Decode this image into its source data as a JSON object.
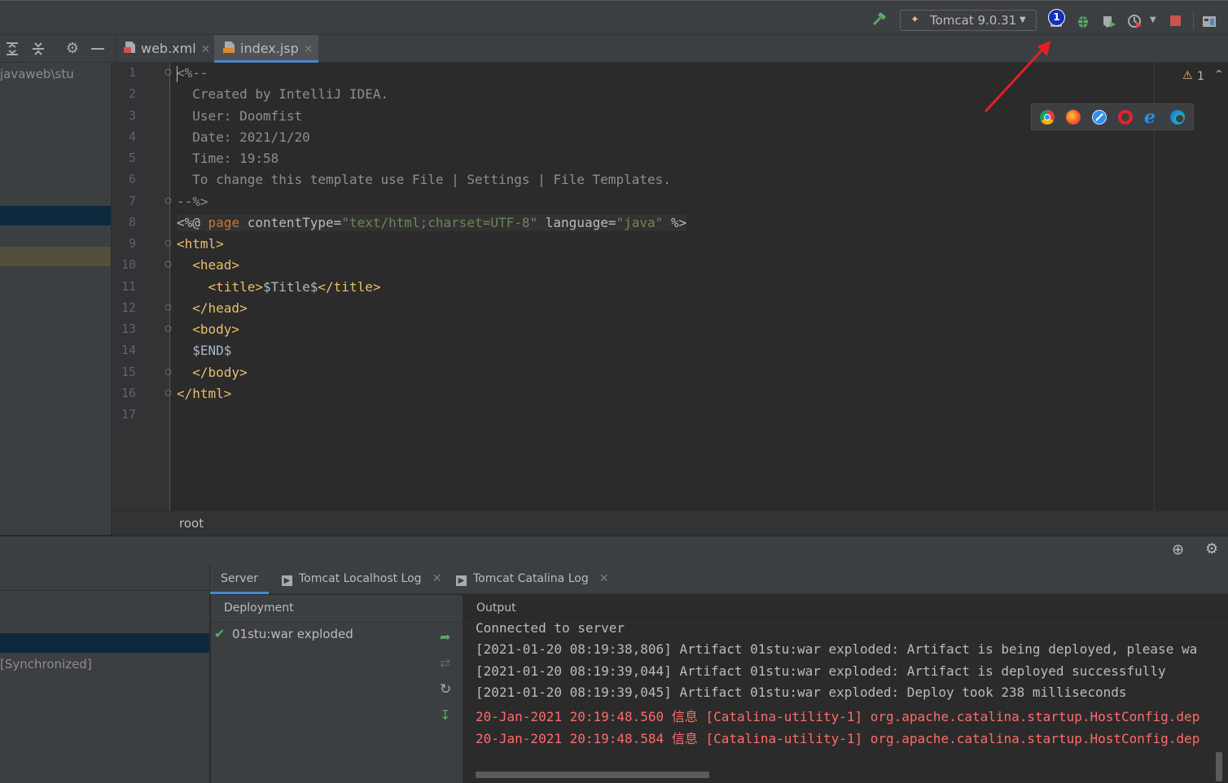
{
  "toolbar": {
    "run_config_label": "Tomcat 9.0.31",
    "annotation_badge": "1"
  },
  "project_pane": {
    "path_text": "javaweb\\stu"
  },
  "tabs": [
    {
      "label": "web.xml",
      "active": false
    },
    {
      "label": "index.jsp",
      "active": true
    }
  ],
  "inspection": {
    "warning_count": "1"
  },
  "editor": {
    "line_numbers": [
      "1",
      "2",
      "3",
      "4",
      "5",
      "6",
      "7",
      "8",
      "9",
      "10",
      "11",
      "12",
      "13",
      "14",
      "15",
      "16",
      "17"
    ],
    "lines": [
      "<%--",
      "  Created by IntelliJ IDEA.",
      "  User: Doomfist",
      "  Date: 2021/1/20",
      "  Time: 19:58",
      "  To change this template use File | Settings | File Templates.",
      "--%>",
      "<%@ page contentType=\"text/html;charset=UTF-8\" language=\"java\" %>",
      "<html>",
      "  <head>",
      "    <title>$Title$</title>",
      "  </head>",
      "  <body>",
      "  $END$",
      "  </body>",
      "</html>",
      ""
    ],
    "breadcrumb": "root"
  },
  "bottom": {
    "left_status": "[Synchronized]",
    "tabs": [
      {
        "label": "Server"
      },
      {
        "label": "Tomcat Localhost Log"
      },
      {
        "label": "Tomcat Catalina Log"
      }
    ],
    "deployment_title": "Deployment",
    "deployment_item": "01stu:war exploded",
    "output_title": "Output",
    "output_lines": [
      {
        "text": "Connected to server",
        "level": "info"
      },
      {
        "text": "[2021-01-20 08:19:38,806] Artifact 01stu:war exploded: Artifact is being deployed, please wa",
        "level": "info"
      },
      {
        "text": "[2021-01-20 08:19:39,044] Artifact 01stu:war exploded: Artifact is deployed successfully",
        "level": "info"
      },
      {
        "text": "[2021-01-20 08:19:39,045] Artifact 01stu:war exploded: Deploy took 238 milliseconds",
        "level": "info"
      },
      {
        "text": "20-Jan-2021 20:19:48.560 信息 [Catalina-utility-1] org.apache.catalina.startup.HostConfig.dep",
        "level": "error"
      },
      {
        "text": "20-Jan-2021 20:19:48.584 信息 [Catalina-utility-1] org.apache.catalina.startup.HostConfig.dep",
        "level": "error"
      }
    ]
  },
  "colors": {
    "background": "#2b2b2b",
    "panel": "#3c3f41",
    "accent_blue": "#4a88c7",
    "error_red": "#ff6b68",
    "success_green": "#59a869",
    "annotation_arrow": "#e52020"
  },
  "icons": [
    "build-hammer-icon",
    "run-config-icon",
    "run-with-coverage-icon",
    "debug-bug-icon",
    "profile-icon",
    "run-history-icon",
    "stop-icon",
    "project-structure-icon",
    "expand-all-icon",
    "collapse-all-icon",
    "gear-icon",
    "minimize-icon",
    "chrome-icon",
    "firefox-icon",
    "safari-icon",
    "opera-icon",
    "ie-icon",
    "edge-icon",
    "crosshair-icon",
    "check-icon",
    "deploy-icon",
    "undeploy-icon",
    "refresh-icon",
    "update-icon",
    "warning-icon",
    "chevron-up-icon"
  ]
}
